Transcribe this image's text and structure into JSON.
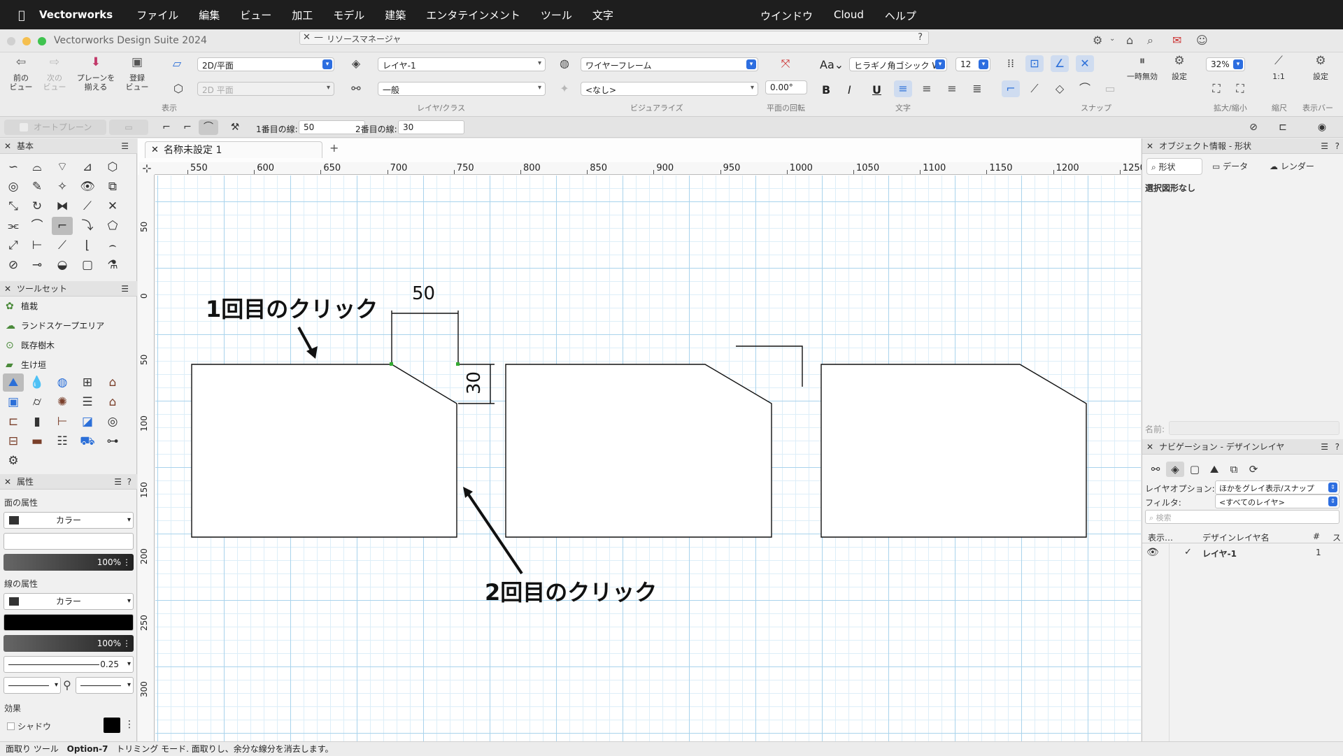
{
  "menubar": {
    "apple": "",
    "app_name": "Vectorworks",
    "items": [
      "ファイル",
      "編集",
      "ビュー",
      "加工",
      "モデル",
      "建築",
      "エンタテインメント",
      "ツール",
      "文字"
    ],
    "right_items": [
      "ウインドウ",
      "Cloud",
      "ヘルプ"
    ]
  },
  "window": {
    "title": "Vectorworks Design Suite 2024"
  },
  "resource_manager": {
    "title": "リソースマネージャ",
    "help": "?",
    "close": "✕"
  },
  "toolbar": {
    "prev_view": "前の\nビュー",
    "next_view": "次の\nビュー",
    "align_plane": "プレーンを\n揃える",
    "saved_view": "登録\nビュー",
    "view_select": "2D/平面",
    "plane_select": "2D 平面",
    "group_view": "表示",
    "layer_select": "レイヤ-1",
    "class_select": "一般",
    "group_layer": "レイヤ/クラス",
    "render_select": "ワイヤーフレーム",
    "light_select": "<なし>",
    "group_visualize": "ビジュアライズ",
    "rotation_value": "0.00°",
    "group_rotation": "平面の回転",
    "font_select": "ヒラギノ角ゴシック W3",
    "size_select": "12",
    "group_text": "文字",
    "group_snap": "スナップ",
    "pause_label": "一時無効",
    "settings_label": "設定",
    "zoom_select": "32%",
    "group_zoom": "拡大/縮小",
    "scale_value": "1:1",
    "group_scale": "縮尺",
    "settings2_label": "設定",
    "group_display": "表示バー",
    "bold": "B",
    "italic": "I",
    "underline": "U",
    "font_aa": "Aa"
  },
  "modebar": {
    "auto_plane": "オートプレーン",
    "first_line_label": "1番目の線:",
    "first_line_value": "50",
    "second_line_label": "2番目の線:",
    "second_line_value": "30"
  },
  "left_panel": {
    "basic_title": "基本",
    "toolset_title": "ツールセット",
    "toolsets": [
      "植栽",
      "ランドスケープエリア",
      "既存樹木",
      "生け垣"
    ],
    "attr_title": "属性",
    "fill_label": "面の属性",
    "fill_type": "カラー",
    "fill_opacity": "100%",
    "line_label": "線の属性",
    "line_type": "カラー",
    "line_opacity": "100%",
    "line_weight": "0.25",
    "effects_label": "効果",
    "shadow_label": "シャドウ",
    "help": "?"
  },
  "document": {
    "tab_title": "名称未設定 1",
    "tab_plus": "+"
  },
  "ruler": {
    "h_labels": [
      "550",
      "600",
      "650",
      "700",
      "750",
      "800",
      "850",
      "900",
      "950",
      "1000",
      "1050",
      "1100",
      "1150",
      "1200",
      "1250"
    ],
    "v_labels": [
      "50",
      "0",
      "50",
      "100",
      "150",
      "200",
      "250",
      "300"
    ]
  },
  "drawing": {
    "label_first_click": "1回目のクリック",
    "label_second_click": "2回目のクリック",
    "dim_horizontal": "50",
    "dim_vertical": "30"
  },
  "right_panel": {
    "oi_title": "オブジェクト情報 - 形状",
    "tabs": [
      "形状",
      "データ",
      "レンダー"
    ],
    "no_selection": "選択図形なし",
    "name_label": "名前:",
    "nav_title": "ナビゲーション - デザインレイヤ",
    "layer_option_label": "レイヤオプション:",
    "layer_option_value": "ほかをグレイ表示/スナップ",
    "filter_label": "フィルタ:",
    "filter_value": "<すべてのレイヤ>",
    "search_placeholder": "検索",
    "col_display": "表示…",
    "col_name": "デザインレイヤ名",
    "col_num": "#",
    "col_s": "ス",
    "layers": [
      {
        "name": "レイヤ-1",
        "num": "1"
      }
    ]
  },
  "statusbar": {
    "text": "面取り ツール",
    "shortcut": "Option-7",
    "desc": "トリミング モード. 面取りし、余分な線分を消去します。"
  }
}
